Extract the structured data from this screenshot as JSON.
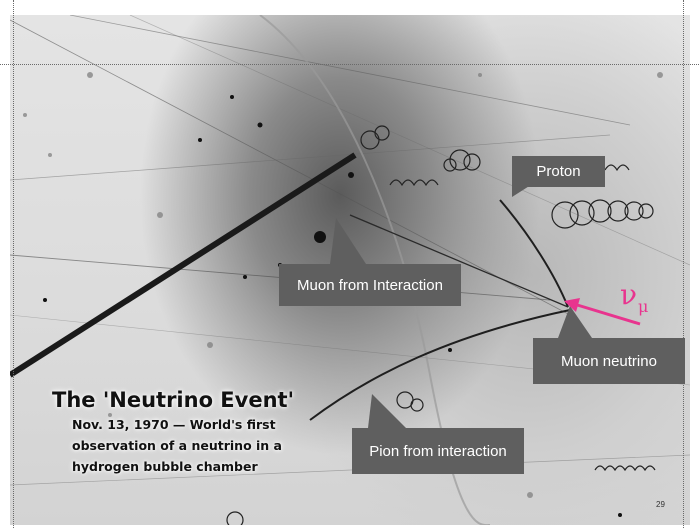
{
  "slide": {
    "title": "The 'Neutrino Event'",
    "subtitle_lines": [
      "Nov. 13, 1970 — World's first",
      "observation of a neutrino in a",
      "hydrogen bubble chamber"
    ],
    "page_number": "29"
  },
  "labels": {
    "proton": "Proton",
    "muon_from_interaction": "Muon from Interaction",
    "muon_neutrino": "Muon neutrino",
    "pion_from_interaction": "Pion from interaction"
  },
  "symbol": {
    "greek": "ν",
    "subscript": "μ"
  },
  "colors": {
    "callout_bg": "#5f5f5f",
    "callout_text": "#ffffff",
    "neutrino_arrow": "#e8348e"
  }
}
